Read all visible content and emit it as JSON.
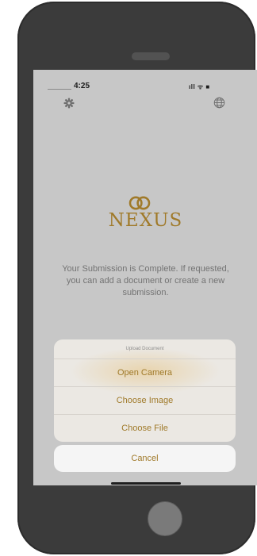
{
  "status_bar": {
    "time": "4:25",
    "signal_icon": "signal-bars-icon",
    "wifi_icon": "wifi-icon",
    "battery_icon": "battery-icon",
    "icons_text": "ıll ᯤ ■"
  },
  "header": {
    "settings_icon": "gear-icon",
    "language_icon": "globe-icon"
  },
  "brand": {
    "name": "NEXUS",
    "color": "#a07a2a"
  },
  "message": "Your Submission is Complete. If requested, you can add a document or create a new submission.",
  "action_sheet": {
    "title": "Upload Document",
    "options": [
      {
        "label": "Open Camera"
      },
      {
        "label": "Choose Image"
      },
      {
        "label": "Choose File"
      }
    ],
    "cancel_label": "Cancel"
  }
}
